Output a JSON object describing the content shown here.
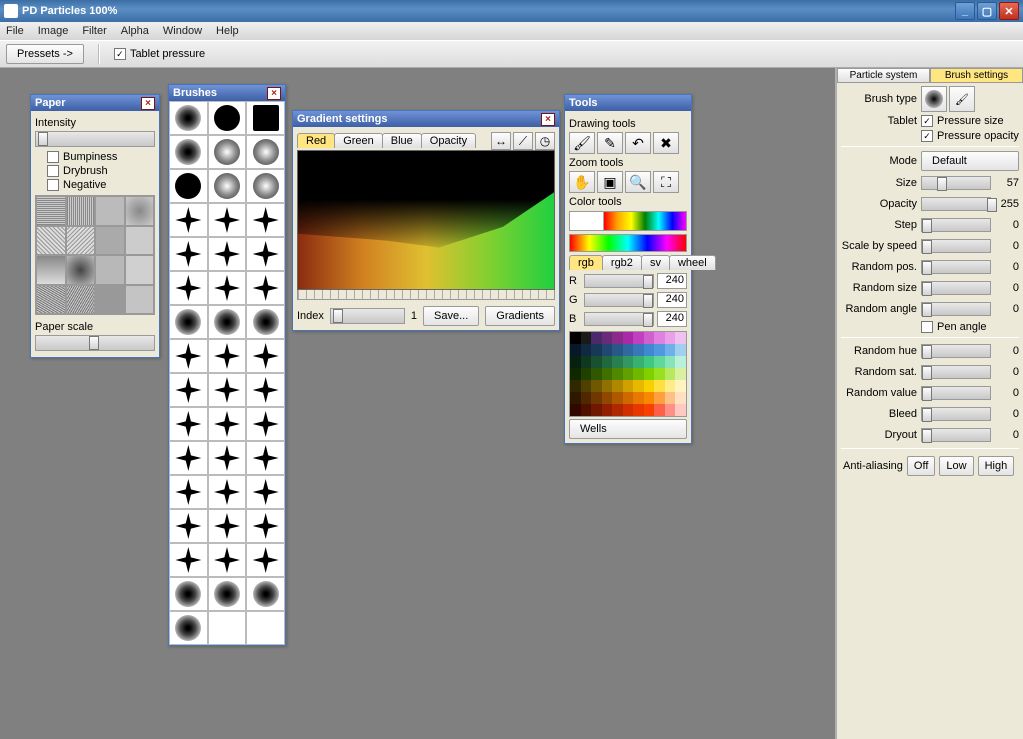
{
  "window": {
    "title": "PD Particles    100%"
  },
  "menu": [
    "File",
    "Image",
    "Filter",
    "Alpha",
    "Window",
    "Help"
  ],
  "toolbar": {
    "pressets": "Pressets  ->",
    "tablet_pressure": "Tablet pressure"
  },
  "paper": {
    "title": "Paper",
    "intensity": "Intensity",
    "bumpiness": "Bumpiness",
    "drybrush": "Drybrush",
    "negative": "Negative",
    "paper_scale": "Paper scale"
  },
  "brushes": {
    "title": "Brushes"
  },
  "gradient": {
    "title": "Gradient settings",
    "tabs": {
      "red": "Red",
      "green": "Green",
      "blue": "Blue",
      "opacity": "Opacity"
    },
    "index": "Index",
    "index_val": "1",
    "save": "Save...",
    "gradients": "Gradients"
  },
  "tools": {
    "title": "Tools",
    "drawing": "Drawing tools",
    "zoom": "Zoom tools",
    "color": "Color tools",
    "tabs": {
      "rgb": "rgb",
      "rgb2": "rgb2",
      "sv": "sv",
      "wheel": "wheel"
    },
    "r": "R",
    "g": "G",
    "b": "B",
    "rv": "240",
    "gv": "240",
    "bv": "240",
    "wells": "Wells"
  },
  "sidebar": {
    "tab1": "Particle system",
    "tab2": "Brush settings",
    "brush_type": "Brush type",
    "tablet": "Tablet",
    "pressure_size": "Pressure size",
    "pressure_opacity": "Pressure opacity",
    "mode": "Mode",
    "mode_btn": "Default",
    "size": "Size",
    "size_v": "57",
    "opacity": "Opacity",
    "opacity_v": "255",
    "step": "Step",
    "step_v": "0",
    "scale_speed": "Scale by speed",
    "scale_speed_v": "0",
    "random_pos": "Random pos.",
    "random_pos_v": "0",
    "random_size": "Random size",
    "random_size_v": "0",
    "random_angle": "Random angle",
    "random_angle_v": "0",
    "pen_angle": "Pen angle",
    "random_hue": "Random hue",
    "random_hue_v": "0",
    "random_sat": "Random sat.",
    "random_sat_v": "0",
    "random_value": "Random value",
    "random_value_v": "0",
    "bleed": "Bleed",
    "bleed_v": "0",
    "dryout": "Dryout",
    "dryout_v": "0",
    "aa": "Anti-aliasing",
    "off": "Off",
    "low": "Low",
    "high": "High"
  },
  "swatch_colors": [
    "#000000",
    "#1a1a1a",
    "#4a2a6a",
    "#6a2a7a",
    "#8a2a8a",
    "#a82aa8",
    "#c040c0",
    "#d060d0",
    "#e080e0",
    "#e8a0e8",
    "#f0c0f0",
    "#081828",
    "#102840",
    "#183858",
    "#204870",
    "#285888",
    "#3068a0",
    "#3878b8",
    "#4088d0",
    "#5098e0",
    "#70b0e8",
    "#a0d0f0",
    "#082010",
    "#103820",
    "#185030",
    "#206840",
    "#288050",
    "#309860",
    "#38b070",
    "#40c880",
    "#60d898",
    "#88e4b8",
    "#b8f0d8",
    "#102800",
    "#204000",
    "#305800",
    "#407000",
    "#508800",
    "#60a000",
    "#70b800",
    "#80d000",
    "#98e020",
    "#b8e860",
    "#d8f0a0",
    "#302800",
    "#504000",
    "#705800",
    "#907000",
    "#b08800",
    "#d0a000",
    "#e8b800",
    "#f8d000",
    "#ffe040",
    "#ffec88",
    "#fff4c0",
    "#301800",
    "#502800",
    "#703800",
    "#904800",
    "#b05800",
    "#d06800",
    "#e87800",
    "#f88800",
    "#ffa040",
    "#ffc088",
    "#ffe0c0",
    "#300800",
    "#501000",
    "#701800",
    "#902000",
    "#b02800",
    "#d03000",
    "#e83800",
    "#f84000",
    "#ff6048",
    "#ff9088",
    "#ffc8c0"
  ]
}
